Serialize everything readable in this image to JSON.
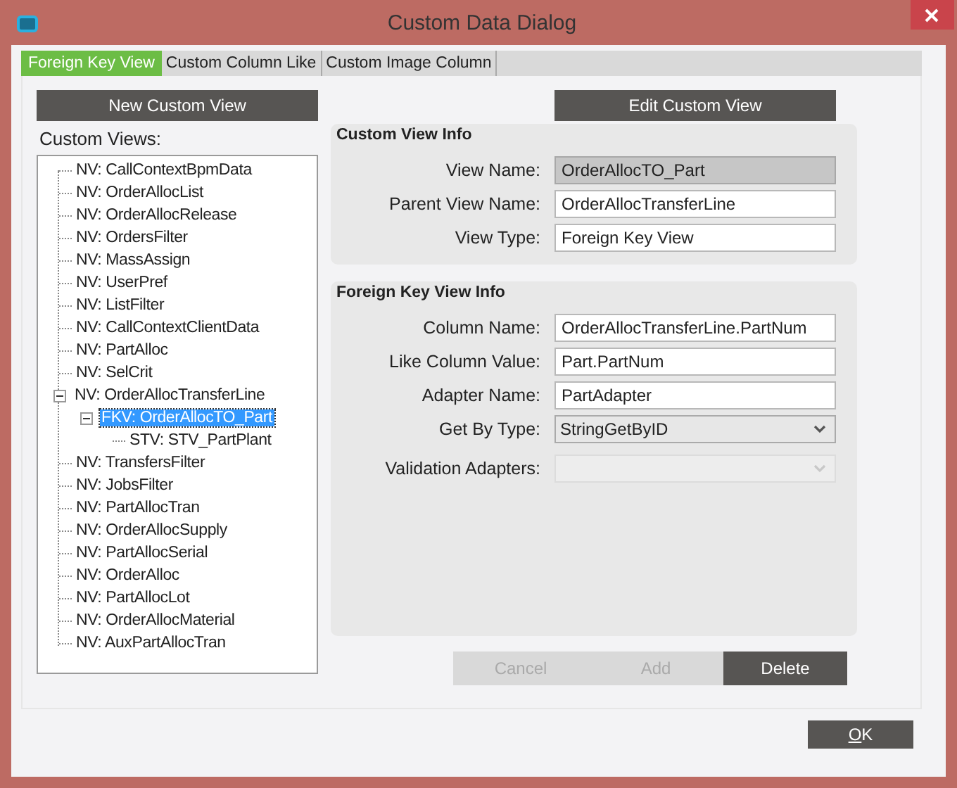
{
  "window": {
    "title": "Custom Data Dialog"
  },
  "tabs": [
    {
      "label": "Foreign Key View",
      "selected": true
    },
    {
      "label": "Custom Column Like",
      "selected": false
    },
    {
      "label": "Custom Image Column",
      "selected": false
    }
  ],
  "new_button": "New Custom View",
  "tree_label": "Custom Views:",
  "tree": [
    {
      "label": "NV: CallContextBpmData",
      "selected": false
    },
    {
      "label": "NV: OrderAllocList",
      "selected": false
    },
    {
      "label": "NV: OrderAllocRelease",
      "selected": false
    },
    {
      "label": "NV: OrdersFilter",
      "selected": false
    },
    {
      "label": "NV: MassAssign",
      "selected": false
    },
    {
      "label": "NV: UserPref",
      "selected": false
    },
    {
      "label": "NV: ListFilter",
      "selected": false
    },
    {
      "label": "NV: CallContextClientData",
      "selected": false
    },
    {
      "label": "NV: PartAlloc",
      "selected": false
    },
    {
      "label": "NV: SelCrit",
      "selected": false
    },
    {
      "label": "NV: OrderAllocTransferLine",
      "selected": false,
      "expanded": true,
      "children": [
        {
          "label": "FKV: OrderAllocTO_Part",
          "selected": true,
          "expanded": true,
          "children": [
            {
              "label": "STV: STV_PartPlant",
              "selected": false
            }
          ]
        }
      ]
    },
    {
      "label": "NV: TransfersFilter",
      "selected": false
    },
    {
      "label": "NV: JobsFilter",
      "selected": false
    },
    {
      "label": "NV: PartAllocTran",
      "selected": false
    },
    {
      "label": "NV: OrderAllocSupply",
      "selected": false
    },
    {
      "label": "NV: PartAllocSerial",
      "selected": false
    },
    {
      "label": "NV: OrderAlloc",
      "selected": false
    },
    {
      "label": "NV: PartAllocLot",
      "selected": false
    },
    {
      "label": "NV: OrderAllocMaterial",
      "selected": false
    },
    {
      "label": "NV: AuxPartAllocTran",
      "selected": false
    }
  ],
  "edit_button": "Edit Custom View",
  "groups": [
    {
      "title": "Custom View Info",
      "fields": [
        {
          "label": "View Name:",
          "kind": "readonly",
          "value": "OrderAllocTO_Part"
        },
        {
          "label": "Parent View Name:",
          "kind": "text",
          "value": "OrderAllocTransferLine"
        },
        {
          "label": "View Type:",
          "kind": "text",
          "value": "Foreign Key View"
        }
      ]
    },
    {
      "title": "Foreign Key View Info",
      "fields": [
        {
          "label": "Column Name:",
          "kind": "text",
          "value": "OrderAllocTransferLine.PartNum"
        },
        {
          "label": "Like Column Value:",
          "kind": "text",
          "value": "Part.PartNum"
        },
        {
          "label": "Adapter Name:",
          "kind": "text",
          "value": "PartAdapter"
        },
        {
          "label": "Get By Type:",
          "kind": "select",
          "value": "StringGetByID",
          "disabled": false
        },
        {
          "label": "Validation Adapters:",
          "kind": "select",
          "disabled": true
        }
      ]
    }
  ],
  "actions": [
    {
      "label": "Cancel",
      "disabled": true
    },
    {
      "label": "Add",
      "disabled": true
    },
    {
      "label": "Delete",
      "disabled": false
    }
  ],
  "ok_button": "OK"
}
